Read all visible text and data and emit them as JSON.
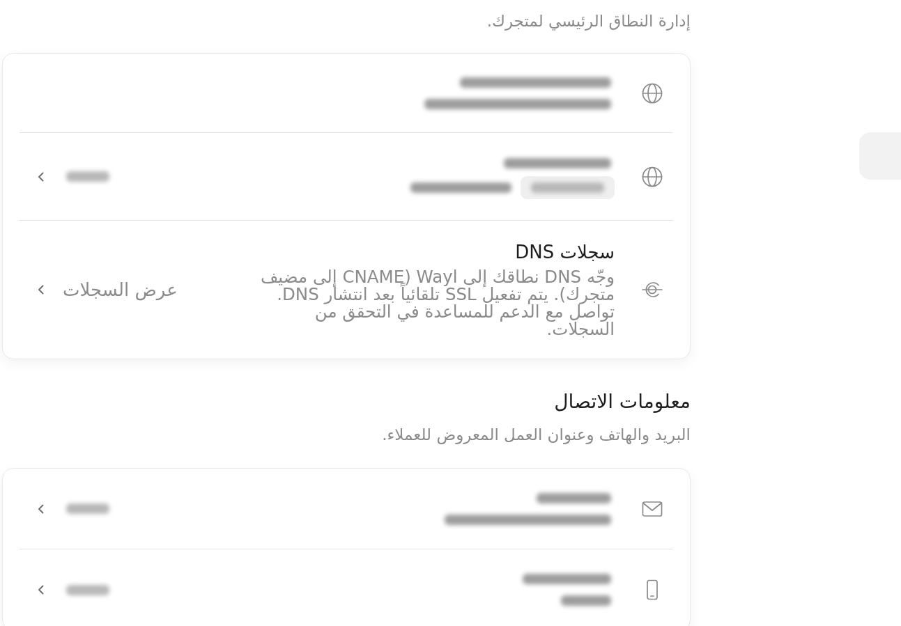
{
  "sections": [
    {
      "description": "إدارة النطاق الرئيسي لمتجرك.",
      "rows": [
        {
          "kind": "redacted",
          "tag": false,
          "actionable": false
        },
        {
          "kind": "redacted",
          "tag": true,
          "actionable": true
        },
        {
          "kind": "text",
          "title": "سجلات DNS",
          "description": "وجّه DNS نطاقك إلى Wayl (CNAME إلى مضيف متجرك). يتم تفعيل SSL تلقائياً بعد انتشار DNS. تواصل مع الدعم للمساعدة في التحقق من السجلات.",
          "action": "عرض السجلات"
        }
      ]
    },
    {
      "title": "معلومات الاتصال",
      "description": "البريد والهاتف وعنوان العمل المعروض للعملاء.",
      "rows": [
        {
          "kind": "redacted",
          "tag": false,
          "actionable": true
        },
        {
          "kind": "redacted",
          "tag": false,
          "actionable": true
        }
      ]
    }
  ]
}
